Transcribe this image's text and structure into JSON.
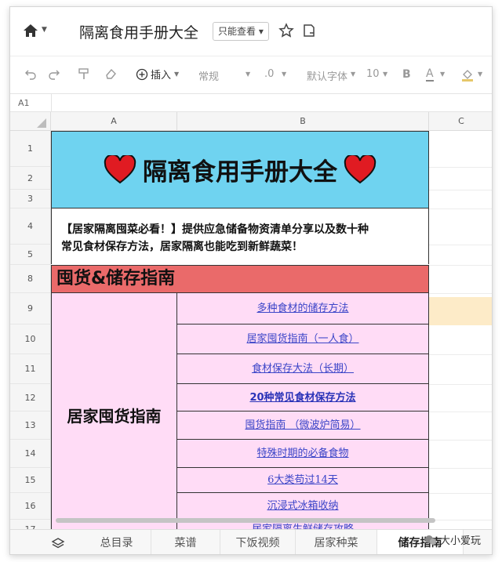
{
  "window": {
    "title": "隔离食用手册大全",
    "permission_label": "只能查看",
    "permission_caret": "▾"
  },
  "toolbar": {
    "insert_label": "插入",
    "number_format": "常规",
    "decimals_label": ".0",
    "font_name": "默认字体",
    "font_size": "10",
    "bold_label": "B",
    "text_color_label": "A"
  },
  "namebar": {
    "cell_ref": "A1"
  },
  "columns": [
    "A",
    "B",
    "C"
  ],
  "rows": [
    "1",
    "2",
    "3",
    "4",
    "5",
    "8",
    "9",
    "10",
    "11",
    "12",
    "13",
    "14",
    "15",
    "16",
    "17"
  ],
  "sheet": {
    "banner_title": "隔离食用手册大全",
    "intro_line1": "【居家隔离囤菜必看！】提供应急储备物资清单分享以及数十种",
    "intro_line2": "常见食材保存方法，居家隔离也能吃到新鲜蔬菜！",
    "section_title": "囤货&储存指南",
    "subcategory": "居家囤货指南",
    "links": [
      "多种食材的储存方法",
      "居家囤货指南（一人食）",
      "食材保存大法（长期）",
      "20种常见食材保存方法",
      "囤货指南 （微波炉简易）",
      "特殊时期的必备食物",
      "6大类苟过14天",
      "沉浸式冰箱收纳",
      "居家隔离生鲜储存攻略"
    ]
  },
  "tabs": [
    "总目录",
    "菜谱",
    "下饭视频",
    "居家种菜",
    "储存指南"
  ],
  "watermark": {
    "text": "大小爱玩"
  },
  "colors": {
    "banner": "#6fd3f0",
    "section": "#ea6a6a",
    "subcategory_bg": "#ffdcf6",
    "link": "#3b45c8",
    "heart": "#e01b22"
  }
}
